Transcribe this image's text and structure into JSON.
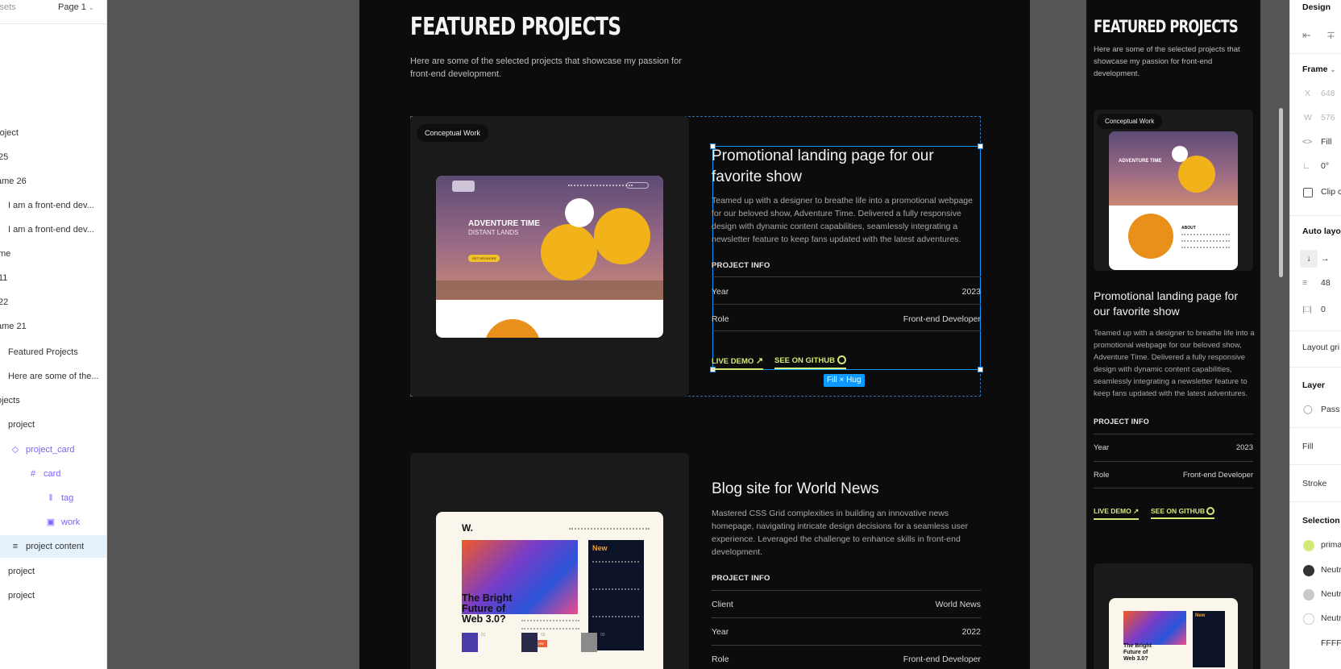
{
  "left_panel": {
    "tab_assets": "ssets",
    "page_selector": "Page 1",
    "layers": [
      {
        "label": "roject"
      },
      {
        "label": "25"
      },
      {
        "label": "ame 26"
      },
      {
        "label": "I am a front-end dev..."
      },
      {
        "label": "I am a front-end dev..."
      },
      {
        "label": "me"
      },
      {
        "label": "11"
      },
      {
        "label": "22"
      },
      {
        "label": "ame 21"
      },
      {
        "label": "Featured Projects"
      },
      {
        "label": "Here are some of the..."
      },
      {
        "label": "ojects"
      },
      {
        "label": "project"
      },
      {
        "label": "project_card"
      },
      {
        "label": "card"
      },
      {
        "label": "tag"
      },
      {
        "label": "work"
      },
      {
        "label": "project content"
      },
      {
        "label": "project"
      },
      {
        "label": "project"
      }
    ]
  },
  "main": {
    "heading": "FEATURED PROJECTS",
    "subtitle_line1": "Here are some of the selected projects that showcase my passion for",
    "subtitle_line2": "front-end development.",
    "projects": [
      {
        "tag": "Conceptual Work",
        "title_line1": "Promotional landing page for our",
        "title_line2": "favorite show",
        "desc_lines": [
          "Teamed up with a designer to breathe life into a promotional webpage",
          "for our beloved show, Adventure Time. Delivered a fully responsive",
          "design with dynamic content capabilities, seamlessly integrating a",
          "newsletter feature to keep fans updated with the latest adventures."
        ],
        "info_heading": "PROJECT INFO",
        "info": [
          {
            "key": "Year",
            "value": "2023"
          },
          {
            "key": "Role",
            "value": "Front-end Developer"
          }
        ],
        "live_demo": "LIVE DEMO",
        "github": "SEE ON GITHUB",
        "size_chip": "Fill × Hug",
        "mock": {
          "headline1": "ADVENTURE TIME",
          "headline2": "DISTANT LANDS",
          "cta": "GET SPOILERS"
        }
      },
      {
        "title": "Blog site for World News",
        "desc_lines": [
          "Mastered CSS Grid complexities in building an innovative news",
          "homepage, navigating intricate design decisions for a seamless user",
          "experience. Leveraged the challenge to enhance skills in  front-end",
          "development."
        ],
        "info_heading": "PROJECT INFO",
        "info": [
          {
            "key": "Client",
            "value": "World News"
          },
          {
            "key": "Year",
            "value": "2022"
          },
          {
            "key": "Role",
            "value": "Front-end Developer"
          }
        ],
        "mock": {
          "logo": "W.",
          "headline": "The Bright Future of Web 3.0?",
          "new_label": "New",
          "read_more": "READ MORE",
          "items": [
            "01",
            "02",
            "03"
          ]
        }
      }
    ]
  },
  "preview": {
    "heading": "FEATURED PROJECTS",
    "subtitle_lines": [
      "Here are some of the selected projects that",
      "showcase my passion for front-end",
      "development."
    ],
    "tag": "Conceptual Work",
    "title_line1": "Promotional landing page for",
    "title_line2": "our favorite show",
    "desc_lines": [
      "Teamed up with a designer to breathe life into a",
      "promotional webpage for our beloved show,",
      "Adventure Time. Delivered a fully responsive",
      "design with dynamic content capabilities,",
      "seamlessly integrating a newsletter feature to",
      "keep fans updated with the latest adventures."
    ],
    "info_heading": "PROJECT INFO",
    "info": [
      {
        "key": "Year",
        "value": "2023"
      },
      {
        "key": "Role",
        "value": "Front-end Developer"
      }
    ],
    "live_demo": "LIVE DEMO",
    "github": "SEE ON GITHUB",
    "mock_about": "ABOUT"
  },
  "right_panel": {
    "design_tab": "Design",
    "frame_label": "Frame",
    "x_label": "X",
    "x_value": "648",
    "w_label": "W",
    "w_value": "576",
    "fill_mode": "Fill",
    "rotation": "0°",
    "clip_label": "Clip c",
    "auto_layout": "Auto layo",
    "gap_value": "48",
    "padding_value": "0",
    "layout_grid": "Layout gri",
    "layer_label": "Layer",
    "pass_label": "Pass",
    "fill_label": "Fill",
    "stroke_label": "Stroke",
    "selection_label": "Selection",
    "selection_colors": [
      {
        "name": "prima",
        "color": "#d3e97a"
      },
      {
        "name": "Neutr",
        "color": "#333333"
      },
      {
        "name": "Neutr",
        "color": "#c8c8c8"
      },
      {
        "name": "Neutr",
        "color": "#ffffff"
      }
    ],
    "hex_value": "FFFFF"
  },
  "colors": {
    "accent": "#d3e97a",
    "selection_blue": "#0d99ff",
    "component_purple": "#7b61ff",
    "frame_bg": "#0c0c0c",
    "card_bg": "#1a1a1a"
  }
}
